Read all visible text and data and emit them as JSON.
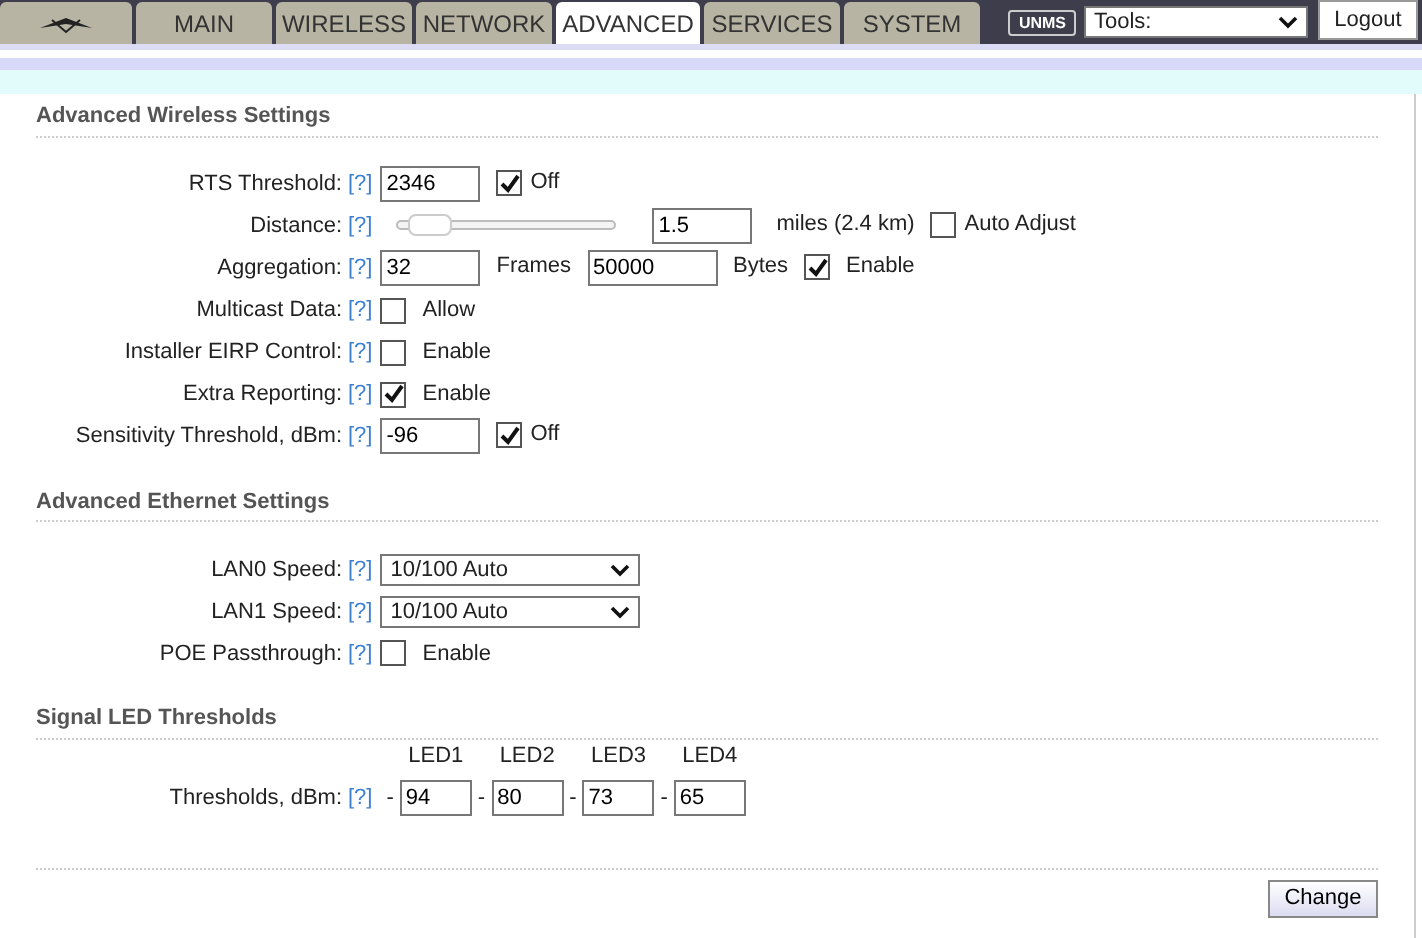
{
  "tabs": [
    {
      "label": "MAIN",
      "selected": false
    },
    {
      "label": "WIRELESS",
      "selected": false
    },
    {
      "label": "NETWORK",
      "selected": false
    },
    {
      "label": "ADVANCED",
      "selected": true
    },
    {
      "label": "SERVICES",
      "selected": false
    },
    {
      "label": "SYSTEM",
      "selected": false
    }
  ],
  "unms_badge": "UNMS",
  "tools_select": {
    "value": "Tools:"
  },
  "logout": "Logout",
  "sections": [
    {
      "title": "Advanced Wireless Settings",
      "rows": [
        {
          "kind": "input_check",
          "label": "RTS Threshold:",
          "help": "[?]",
          "value": "2346",
          "checked": true,
          "check_label": "Off"
        },
        {
          "kind": "slider",
          "label": "Distance:",
          "help": "[?]",
          "level": 0.05,
          "value": "1.5",
          "unit": "miles (2.4 km)",
          "checked": false,
          "check_label": "Auto Adjust"
        },
        {
          "kind": "aggregation",
          "label": "Aggregation:",
          "help": "[?]",
          "value": "32",
          "unit": "Frames",
          "value2": "50000",
          "unit2": "Bytes",
          "checked": true,
          "check_label": "Enable"
        },
        {
          "kind": "check",
          "label": "Multicast Data:",
          "help": "[?]",
          "checked": false,
          "check_label": "Allow"
        },
        {
          "kind": "check",
          "label": "Installer EIRP Control:",
          "help": "[?]",
          "checked": false,
          "check_label": "Enable"
        },
        {
          "kind": "check",
          "label": "Extra Reporting:",
          "help": "[?]",
          "checked": true,
          "check_label": "Enable"
        },
        {
          "kind": "input_check",
          "label": "Sensitivity Threshold, dBm:",
          "help": "[?]",
          "value": "-96",
          "checked": true,
          "check_label": "Off"
        }
      ]
    },
    {
      "title": "Advanced Ethernet Settings",
      "rows": [
        {
          "kind": "select",
          "label": "LAN0 Speed:",
          "help": "[?]",
          "value": "10/100 Auto"
        },
        {
          "kind": "select",
          "label": "LAN1 Speed:",
          "help": "[?]",
          "value": "10/100 Auto"
        },
        {
          "kind": "check",
          "label": "POE Passthrough:",
          "help": "[?]",
          "checked": false,
          "check_label": "Enable"
        }
      ]
    },
    {
      "title": "Signal LED Thresholds",
      "rows": [
        {
          "kind": "leds",
          "label": "Thresholds, dBm:",
          "help": "[?]",
          "leds": [
            {
              "name": "LED1",
              "sign": "-",
              "value": "94"
            },
            {
              "name": "LED2",
              "sign": "-",
              "value": "80"
            },
            {
              "name": "LED3",
              "sign": "-",
              "value": "73"
            },
            {
              "name": "LED4",
              "sign": "-",
              "value": "65"
            }
          ]
        }
      ]
    }
  ],
  "change_button": "Change"
}
